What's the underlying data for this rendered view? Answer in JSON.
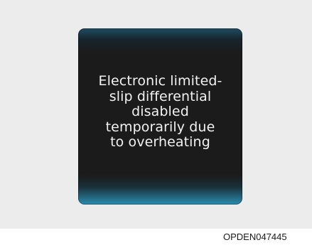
{
  "display": {
    "message": "Electronic limited-\nslip differential\ndisabled\ntemporarily due\nto overheating"
  },
  "figure": {
    "code": "OPDEN047445"
  },
  "colors": {
    "panel_background": "#ececec",
    "display_background": "#1b1b1b",
    "display_glow": "#2b8db0",
    "message_text": "#f2f2f2"
  }
}
